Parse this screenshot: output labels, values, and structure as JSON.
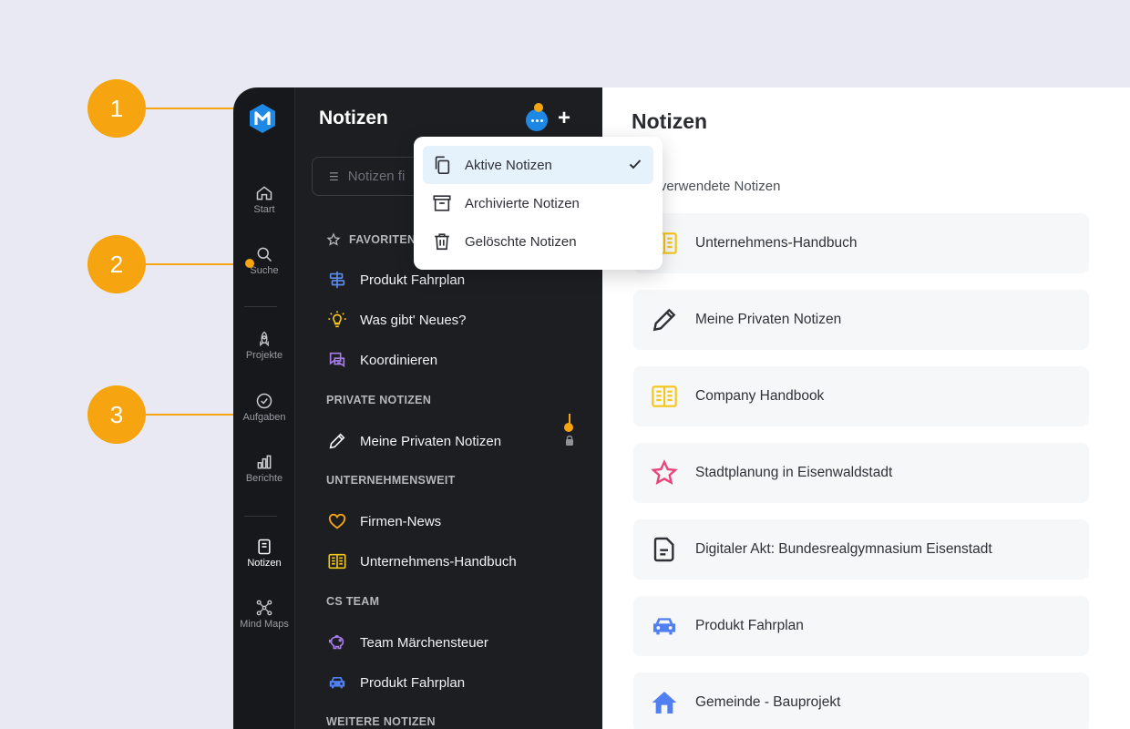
{
  "colors": {
    "background": "#e9e9f4",
    "rail": "#17181b",
    "panel": "#1d1e21",
    "accent": "#1e88e5",
    "callout": "#f6a40f"
  },
  "rail": {
    "items": [
      {
        "label": "Start",
        "icon": "home-icon"
      },
      {
        "label": "Suche",
        "icon": "search-icon"
      },
      {
        "label": "Projekte",
        "icon": "rocket-icon"
      },
      {
        "label": "Aufgaben",
        "icon": "check-circle-icon"
      },
      {
        "label": "Berichte",
        "icon": "bar-chart-icon"
      },
      {
        "label": "Notizen",
        "icon": "note-icon",
        "active": true
      },
      {
        "label": "Mind Maps",
        "icon": "mindmap-icon"
      }
    ]
  },
  "panel": {
    "title": "Notizen",
    "filter_placeholder": "Notizen fi",
    "sections": {
      "favoriten": "FAVORITEN",
      "private": "PRIVATE NOTIZEN",
      "unternehmen": "UNTERNEHMENSWEIT",
      "cs_team": "CS TEAM",
      "weitere": "WEITERE NOTIZEN"
    },
    "favoriten": [
      {
        "label": "Produkt Fahrplan",
        "icon": "signpost-icon"
      },
      {
        "label": "Was gibt' Neues?",
        "icon": "lightbulb-icon"
      },
      {
        "label": "Koordinieren",
        "icon": "chat-icon"
      }
    ],
    "private": [
      {
        "label": "Meine Privaten Notizen",
        "icon": "pencil-icon"
      }
    ],
    "unternehmen": [
      {
        "label": "Firmen-News",
        "icon": "heart-icon"
      },
      {
        "label": "Unternehmens-Handbuch",
        "icon": "book-icon"
      }
    ],
    "cs_team": [
      {
        "label": "Team Märchensteuer",
        "icon": "piggy-bank-icon"
      },
      {
        "label": "Produkt Fahrplan",
        "icon": "car-icon"
      }
    ]
  },
  "dropdown": {
    "items": [
      {
        "label": "Aktive Notizen",
        "icon": "copy-icon",
        "selected": true
      },
      {
        "label": "Archivierte Notizen",
        "icon": "archive-icon"
      },
      {
        "label": "Gelöschte Notizen",
        "icon": "trash-icon"
      }
    ]
  },
  "main": {
    "title": "Notizen",
    "subtitle": "tlich verwendete Notizen",
    "cards": [
      {
        "label": "Unternehmens-Handbuch",
        "icon": "book-icon"
      },
      {
        "label": "Meine Privaten Notizen",
        "icon": "pencil-icon"
      },
      {
        "label": "Company Handbook",
        "icon": "book-icon"
      },
      {
        "label": "Stadtplanung in Eisenwaldstadt",
        "icon": "star-icon"
      },
      {
        "label": "Digitaler Akt: Bundesrealgymnasium Eisenstadt",
        "icon": "document-icon"
      },
      {
        "label": "Produkt Fahrplan",
        "icon": "car-icon"
      },
      {
        "label": "Gemeinde - Bauprojekt",
        "icon": "house-icon"
      }
    ]
  },
  "callouts": [
    "1",
    "2",
    "3"
  ]
}
